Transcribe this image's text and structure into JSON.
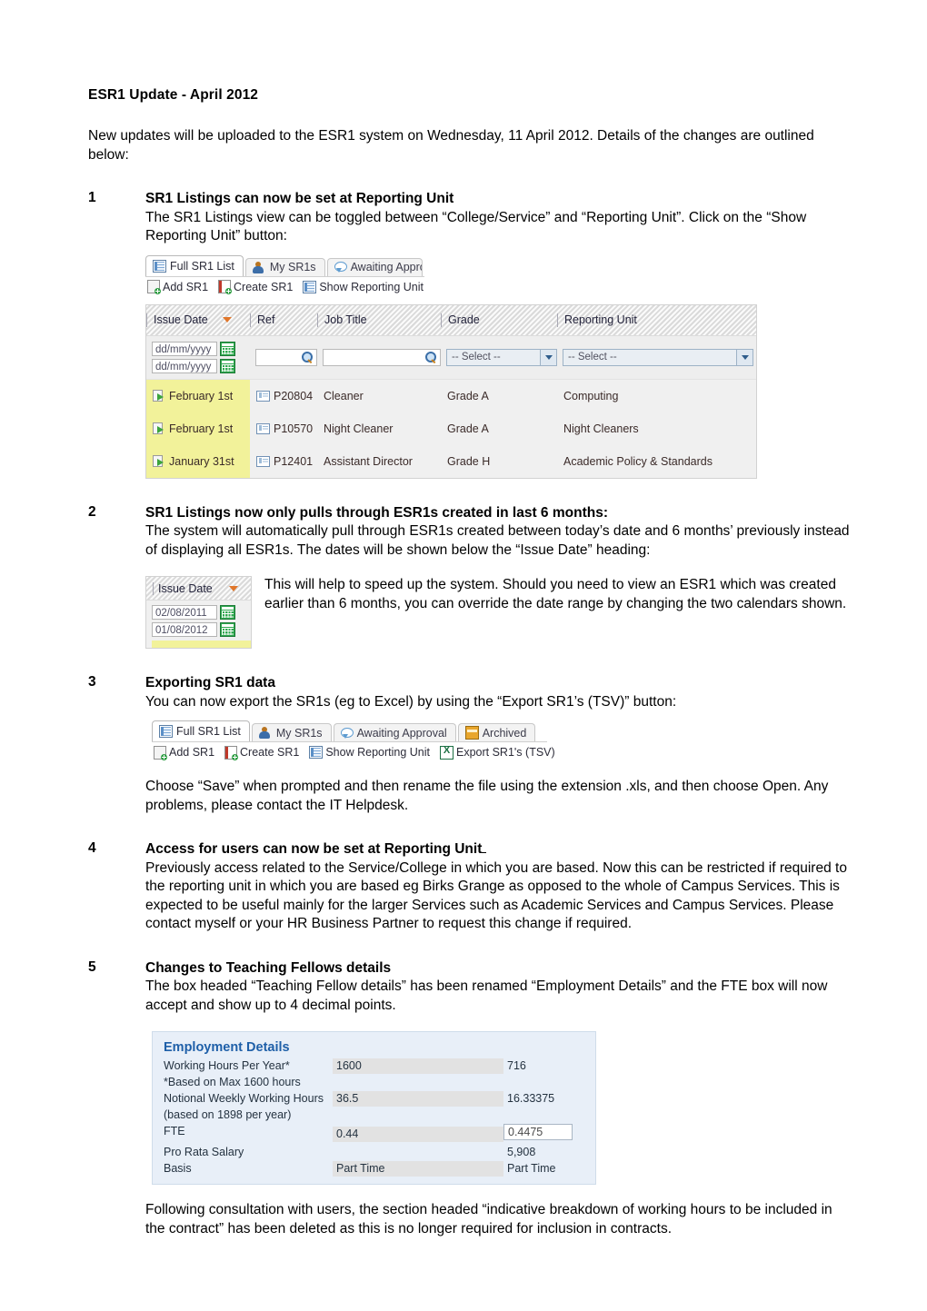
{
  "document": {
    "title": "ESR1 Update - April 2012",
    "intro": "New updates will be uploaded to the ESR1 system on Wednesday, 11 April 2012.  Details of the changes are outlined below:"
  },
  "sections": [
    {
      "number": "1",
      "heading": "SR1 Listings can now be set at Reporting Unit",
      "body": "The SR1 Listings view can be toggled between “College/Service” and “Reporting Unit”.  Click on the “Show Reporting Unit” button:"
    },
    {
      "number": "2",
      "heading": "SR1 Listings now only pulls through ESR1s created in last 6 months:",
      "body": "The system will automatically pull through ESR1s created between today’s date and 6 months’ previously instead of displaying all ESR1s.  The dates will be shown below the “Issue Date” heading:",
      "body2": "This will help to speed up the system.  Should you need to view an ESR1 which was created earlier than 6 months, you can override the date range by changing the two calendars shown."
    },
    {
      "number": "3",
      "heading": "Exporting SR1 data",
      "body": "You can now export the SR1s (eg to Excel) by using the “Export SR1’s (TSV)” button:",
      "body2": "Choose “Save” when prompted and then rename the file using the extension .xls, and then choose Open.  Any problems, please contact the IT Helpdesk."
    },
    {
      "number": "4",
      "heading": "Access for users can now be set at Reporting Unit",
      "body": "Previously access related to the Service/College in which you are based.  Now this can be restricted if required to the reporting unit in which you are based eg Birks Grange as opposed to the whole of Campus Services.  This is expected to be useful mainly for the larger Services such as Academic Services and Campus Services.  Please contact myself or your HR Business Partner to request this change if required."
    },
    {
      "number": "5",
      "heading": "Changes to Teaching Fellows details",
      "body": "The box headed “Teaching Fellow details” has been renamed “Employment Details” and the FTE box will now accept and show up to 4 decimal points.",
      "body2": "Following consultation with users, the section headed “indicative breakdown of working hours to be included in the contract” has been deleted as this is no longer required for inclusion in contracts."
    }
  ],
  "screenshot1": {
    "tabs": [
      {
        "label": "Full SR1 List",
        "icon": "list-icon",
        "active": true
      },
      {
        "label": "My SR1s",
        "icon": "user-icon",
        "active": false
      },
      {
        "label": "Awaiting Approv",
        "icon": "speech-bubble-icon",
        "active": false
      }
    ],
    "toolbar": [
      {
        "label": "Add SR1",
        "icon": "add-page-icon"
      },
      {
        "label": "Create SR1",
        "icon": "create-document-icon"
      },
      {
        "label": "Show Reporting Unit",
        "icon": "list-icon"
      }
    ],
    "grid": {
      "columns": [
        "Issue Date",
        "Ref",
        "Job Title",
        "Grade",
        "Reporting Unit"
      ],
      "sort_column": "Issue Date",
      "sort_direction": "descending",
      "filters": {
        "date_from_placeholder": "dd/mm/yyyy",
        "date_to_placeholder": "dd/mm/yyyy",
        "ref_value": "",
        "job_title_value": "",
        "grade_select": "-- Select --",
        "reporting_unit_select": "-- Select --"
      },
      "rows": [
        {
          "issue_date": "February 1st",
          "ref": "P20804",
          "job_title": "Cleaner",
          "grade": "Grade A",
          "reporting_unit": "Computing"
        },
        {
          "issue_date": "February 1st",
          "ref": "P10570",
          "job_title": "Night Cleaner",
          "grade": "Grade A",
          "reporting_unit": "Night Cleaners"
        },
        {
          "issue_date": "January 31st",
          "ref": "P12401",
          "job_title": "Assistant Director",
          "grade": "Grade H",
          "reporting_unit": "Academic Policy & Standards"
        }
      ]
    }
  },
  "screenshot2": {
    "column_header": "Issue Date",
    "sort_direction": "descending",
    "date_from": "02/08/2011",
    "date_to": "01/08/2012"
  },
  "screenshot3": {
    "tabs": [
      {
        "label": "Full SR1 List",
        "icon": "list-icon",
        "active": true
      },
      {
        "label": "My SR1s",
        "icon": "user-icon",
        "active": false
      },
      {
        "label": "Awaiting Approval",
        "icon": "speech-bubble-icon",
        "active": false
      },
      {
        "label": "Archived",
        "icon": "archive-box-icon",
        "active": false
      }
    ],
    "toolbar": [
      {
        "label": "Add SR1",
        "icon": "add-page-icon"
      },
      {
        "label": "Create SR1",
        "icon": "create-document-icon"
      },
      {
        "label": "Show Reporting Unit",
        "icon": "list-icon"
      },
      {
        "label": "Export SR1's (TSV)",
        "icon": "excel-icon"
      }
    ]
  },
  "employment_details": {
    "title": "Employment Details",
    "rows": [
      {
        "label": "Working Hours Per Year*",
        "value1": "1600",
        "value2": "716",
        "v1style": "field",
        "v2style": "plain"
      },
      {
        "label": "*Based on Max 1600 hours",
        "value1": "",
        "value2": "",
        "v1style": "none",
        "v2style": "plain"
      },
      {
        "label": "Notional Weekly Working Hours",
        "value1": "36.5",
        "value2": "16.33375",
        "v1style": "field",
        "v2style": "plain"
      },
      {
        "label": "(based on 1898 per year)",
        "value1": "",
        "value2": "",
        "v1style": "none",
        "v2style": "plain"
      },
      {
        "label": "FTE",
        "value1": "0.44",
        "value2": "0.4475",
        "v1style": "field",
        "v2style": "boxed"
      },
      {
        "label": "Pro Rata Salary",
        "value1": "",
        "value2": "5,908",
        "v1style": "field",
        "v2style": "plain"
      },
      {
        "label": "Basis",
        "value1": "Part Time",
        "value2": "Part Time",
        "v1style": "field",
        "v2style": "plain"
      }
    ]
  },
  "colors": {
    "highlight_yellow": "#f2f29a",
    "panel_blue": "#e8eff8",
    "panel_title_blue": "#1e5fa8",
    "sort_arrow_orange": "#e0762a"
  }
}
